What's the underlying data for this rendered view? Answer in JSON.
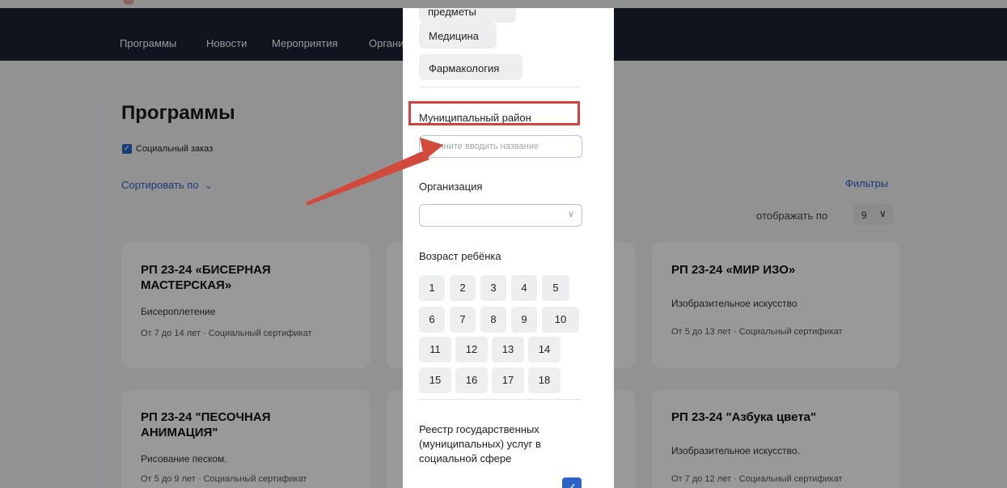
{
  "nav": {
    "items": [
      "Программы",
      "Новости",
      "Мероприятия",
      "Органи"
    ]
  },
  "page": {
    "title": "Программы",
    "social_order_checkbox": "Социальный заказ",
    "sort_label": "Сортировать по",
    "filters_link": "Фильтры",
    "display_label": "отображать по",
    "display_value": "9"
  },
  "cards": [
    {
      "title": "РП 23-24 «БИСЕРНАЯ МАСТЕРСКАЯ»",
      "subtitle": "Бисероплетение",
      "meta": "От 7 до 14 лет · Социальный сертификат"
    },
    {
      "title": "РП 23-24 «МИР ИЗО»",
      "subtitle": "Изобразительное искусство",
      "meta": "От 5 до 13 лет · Социальный сертификат"
    },
    {
      "title": "РП 23-24 \"ПЕСОЧНАЯ АНИМАЦИЯ\"",
      "subtitle": "Рисование песком.",
      "meta": "От 5 до 9 лет · Социальный сертификат"
    },
    {
      "title": "РП 23-24 \"Азбука цвета\"",
      "subtitle": "Изобразительное искусство.",
      "meta": "От 7 до 12 лет · Социальный сертификат"
    }
  ],
  "filter_panel": {
    "subject_chips": [
      "предметы",
      "Медицина",
      "Фармакология"
    ],
    "municipal_label": "Муниципальный район",
    "municipal_placeholder": "Начните вводить название",
    "organization_label": "Организация",
    "age_label": "Возраст ребёнка",
    "ages": [
      "1",
      "2",
      "3",
      "4",
      "5",
      "6",
      "7",
      "8",
      "9",
      "10",
      "11",
      "12",
      "13",
      "14",
      "15",
      "16",
      "17",
      "18"
    ],
    "registry_label": "Реестр государственных (муниципальных) услуг в социальной сфере",
    "registry_checked": true
  },
  "colors": {
    "accent": "#2b63c9",
    "annotation": "#d7403b",
    "navbar": "#1a2233"
  }
}
